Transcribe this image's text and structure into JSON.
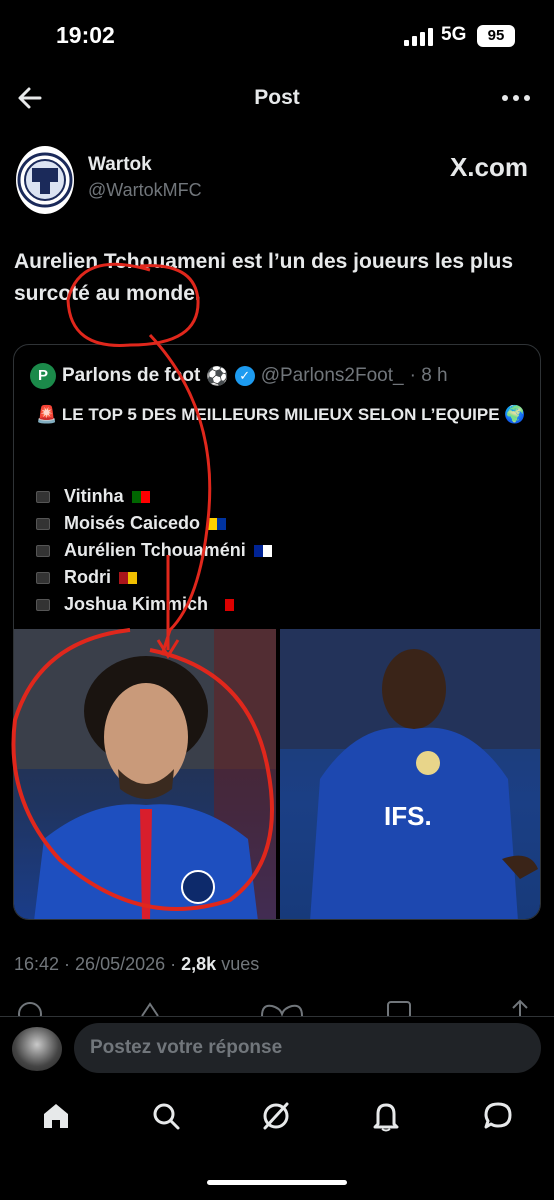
{
  "status_bar": {
    "time": "19:02",
    "network": "5G",
    "battery": "95"
  },
  "header": {
    "title": "Post"
  },
  "author": {
    "name": "Wartok",
    "handle": "@WartokMFC"
  },
  "source": "X.com",
  "tweet": {
    "text": "Aurelien Tchouameni est l’un des joueurs les plus surcoté au monde."
  },
  "quote": {
    "name": "Parlons de foot",
    "handle": "@Parlons2Foot_",
    "time": "· 8 h",
    "headline": "🚨 LE TOP 5 DES MEILLEURS MILIEUX SELON L’EQUIPE 🌍",
    "players": [
      "Vitinha",
      "Moisés Caicedo",
      "Aurélien Tchouaméni",
      "Rodri",
      "Joshua Kimmich"
    ],
    "flags": [
      [
        "#006600",
        "#ff0000"
      ],
      [
        "#ffd100",
        "#0033a0"
      ],
      [
        "#002395",
        "#ffffff"
      ],
      [
        "#aa151b",
        "#f1bf00"
      ],
      [
        "#000000",
        "#dd0000"
      ]
    ]
  },
  "meta": {
    "time": "16:42",
    "date": "26/05/2026",
    "views_count": "2,8k",
    "views_label": "vues"
  },
  "reply": {
    "placeholder": "Postez votre réponse"
  },
  "tabs": [
    "home-icon",
    "search-icon",
    "grok-icon",
    "notifications-icon",
    "messages-icon"
  ],
  "colors": {
    "accent": "#1d9bf0",
    "annotation": "#e0271c",
    "background": "#000000"
  }
}
